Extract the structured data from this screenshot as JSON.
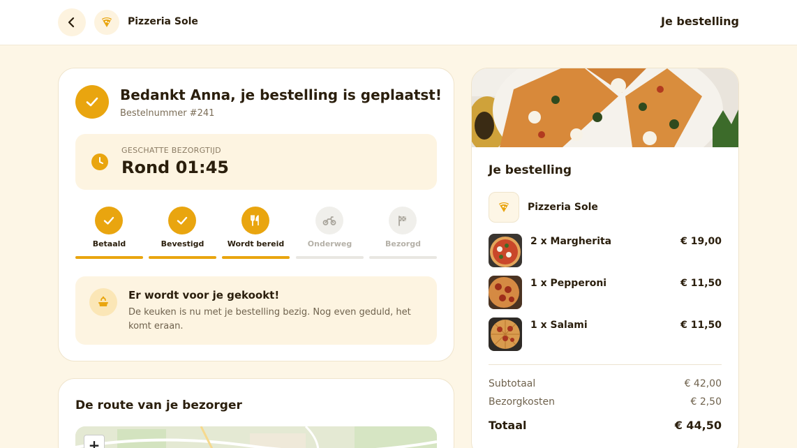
{
  "header": {
    "back_icon": "chevron-left-icon",
    "logo_icon": "pizza-slice-icon",
    "restaurant_name": "Pizzeria Sole",
    "title": "Je bestelling"
  },
  "status": {
    "thanks": "Bedankt Anna, je bestelling is geplaatst!",
    "order_number": "Bestelnummer #241",
    "eta_label": "GESCHATTE BEZORGTIJD",
    "eta_value": "Rond 01:45",
    "steps": [
      {
        "label": "Betaald",
        "state": "done",
        "icon": "check-icon"
      },
      {
        "label": "Bevestigd",
        "state": "done",
        "icon": "check-icon"
      },
      {
        "label": "Wordt bereid",
        "state": "done",
        "icon": "cutlery-icon"
      },
      {
        "label": "Onderweg",
        "state": "todo",
        "icon": "scooter-icon"
      },
      {
        "label": "Bezorgd",
        "state": "todo",
        "icon": "flag-icon"
      }
    ],
    "cook_title": "Er wordt voor je gekookt!",
    "cook_text": "De keuken is nu met je bestelling bezig. Nog even geduld, het komt eraan."
  },
  "route": {
    "title": "De route van je bezorger",
    "zoom_in": "+"
  },
  "order": {
    "title": "Je bestelling",
    "restaurant_name": "Pizzeria Sole",
    "items": [
      {
        "name": "2 x Margherita",
        "price": "€ 19,00"
      },
      {
        "name": "1 x Pepperoni",
        "price": "€ 11,50"
      },
      {
        "name": "1 x Salami",
        "price": "€ 11,50"
      }
    ],
    "subtotal_label": "Subtotaal",
    "subtotal_value": "€ 42,00",
    "delivery_label": "Bezorgkosten",
    "delivery_value": "€ 2,50",
    "total_label": "Totaal",
    "total_value": "€ 44,50"
  },
  "colors": {
    "accent": "#e9a50f",
    "background": "#fdf6e6",
    "panel": "#fdf4e1"
  }
}
